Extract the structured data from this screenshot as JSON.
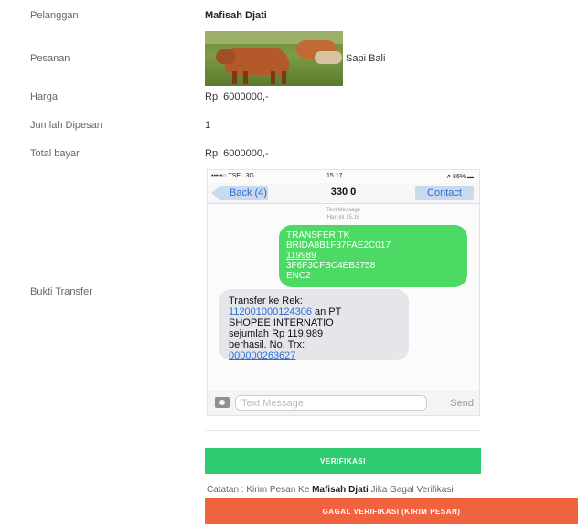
{
  "rows": {
    "pelanggan": {
      "label": "Pelanggan",
      "value": "Mafisah Djati"
    },
    "pesanan": {
      "label": "Pesanan",
      "value": "Sapi Bali"
    },
    "harga": {
      "label": "Harga",
      "value": "Rp. 6000000,-"
    },
    "jumlah": {
      "label": "Jumlah Dipesan",
      "value": "1"
    },
    "total": {
      "label": "Total bayar",
      "value": "Rp. 6000000,-"
    },
    "bukti": {
      "label": "Bukti Transfer"
    }
  },
  "phone": {
    "carrier": "•••••○ TSEL  3G",
    "time": "15.17",
    "battery": "⇗ 86% ▬",
    "back_label": "Back (4)",
    "title": "330 0",
    "contact_label": "Contact",
    "text_message_header": "Text Message",
    "text_message_date": "Hari ini 15.16",
    "sent_lines": [
      "TRANSFER TK",
      "BRIDA8B1F37FAE2C017",
      "119989",
      "3F6F3CFBC4EB3758",
      "ENC2"
    ],
    "recv_line1": "Transfer ke Rek:",
    "recv_account": "112001000124306",
    "recv_line2_rest": " an PT",
    "recv_line3": "SHOPEE INTERNATIO",
    "recv_line4": "sejumlah Rp 119,989",
    "recv_line5": "berhasil. No. Trx:",
    "recv_trx": "000000263627",
    "input_placeholder": "Text Message",
    "send_label": "Send"
  },
  "actions": {
    "verify_label": "VERIFIKASI",
    "note_prefix": "Catatan : Kirim Pesan Ke ",
    "note_name": "Mafisah Djati",
    "note_suffix": " Jika Gagal Verifikasi",
    "fail_label": "GAGAL VERIFIKASI (KIRIM PESAN)"
  },
  "colors": {
    "verify": "#2ecc71",
    "fail": "#f0633e",
    "imessage_green": "#4cd964",
    "link_blue": "#2a6fd6"
  }
}
